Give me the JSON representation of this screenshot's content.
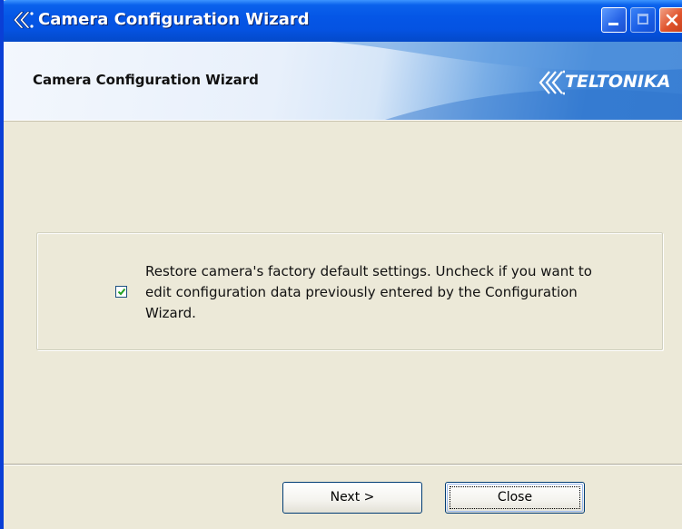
{
  "window": {
    "title": "Camera Configuration Wizard"
  },
  "header": {
    "title": "Camera Configuration Wizard",
    "logo_text": "TELTONIKA"
  },
  "options": {
    "restore_defaults": {
      "checked": true,
      "label": "Restore camera's factory default settings. Uncheck if you want to edit configuration data previously entered by the Configuration Wizard."
    }
  },
  "buttons": {
    "next_label": "Next >",
    "close_label": "Close"
  },
  "colors": {
    "titlebar": "#0556e6",
    "dialog_bg": "#ece9d8",
    "close_button": "#e0532c"
  }
}
